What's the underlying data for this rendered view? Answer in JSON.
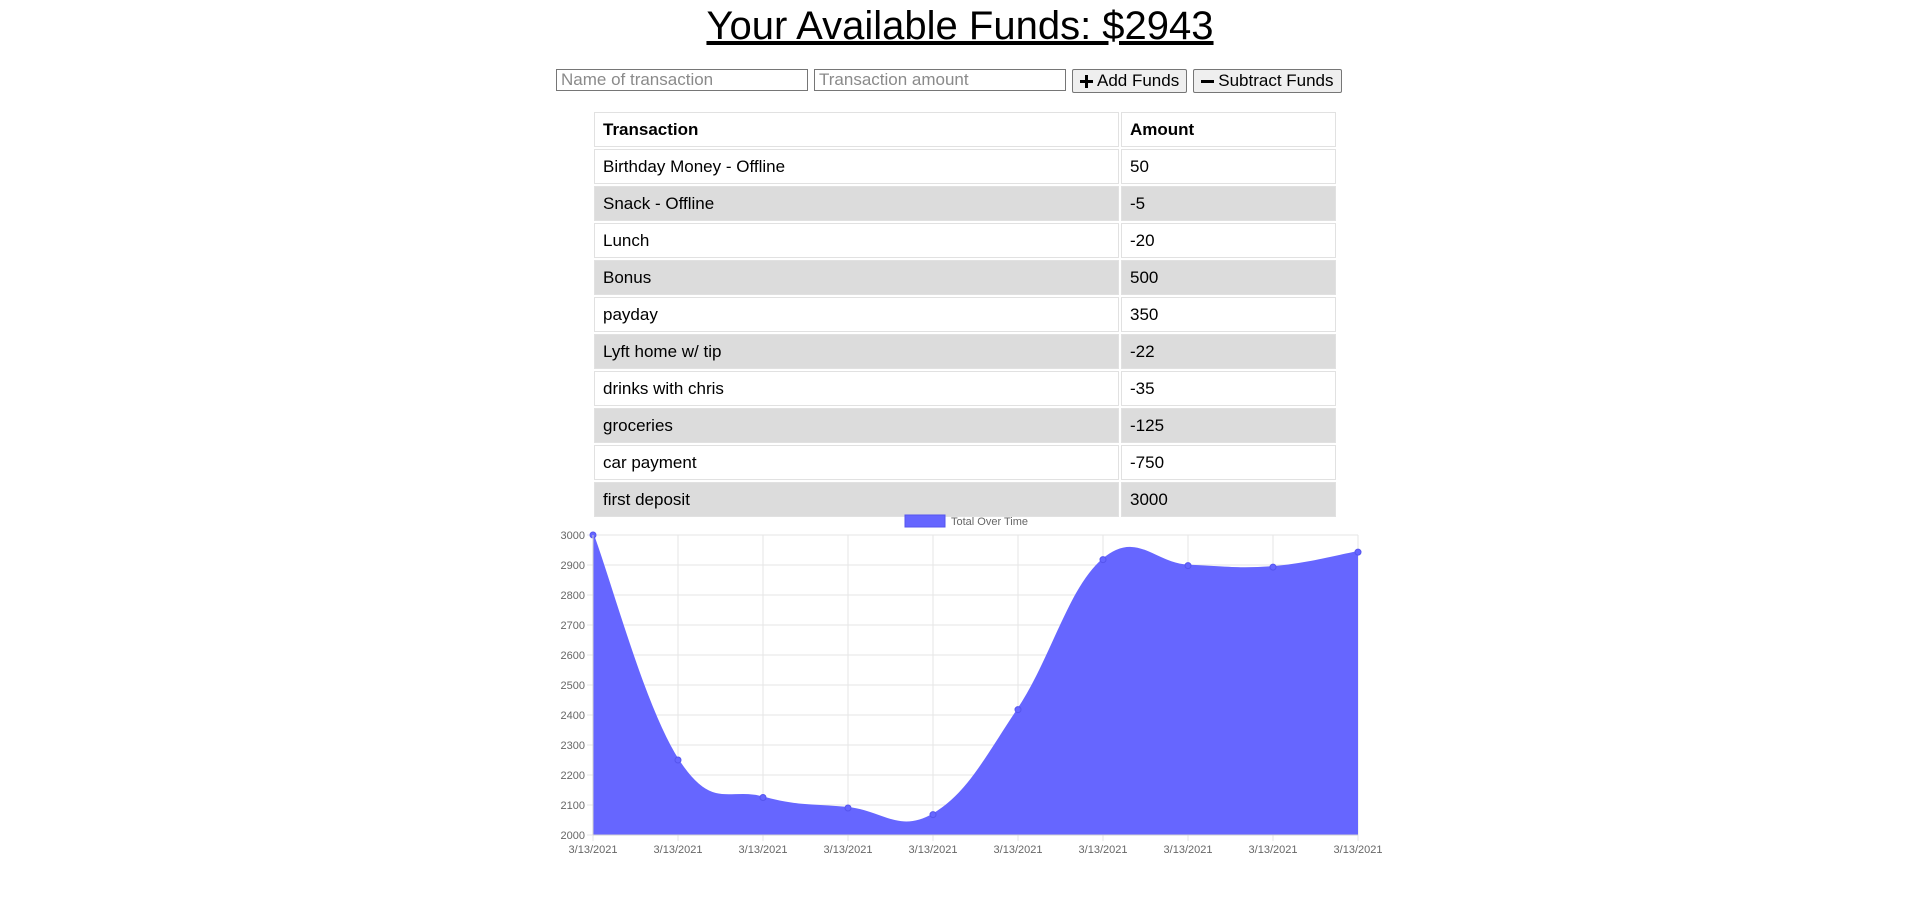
{
  "header": {
    "title": "Your Available Funds: $2943"
  },
  "form": {
    "name_placeholder": "Name of transaction",
    "amount_placeholder": "Transaction amount",
    "add_label": "Add Funds",
    "subtract_label": "Subtract Funds"
  },
  "table": {
    "headers": [
      "Transaction",
      "Amount"
    ],
    "rows": [
      {
        "name": "Birthday Money - Offline",
        "amount": "50"
      },
      {
        "name": "Snack - Offline",
        "amount": "-5"
      },
      {
        "name": "Lunch",
        "amount": "-20"
      },
      {
        "name": "Bonus",
        "amount": "500"
      },
      {
        "name": "payday",
        "amount": "350"
      },
      {
        "name": "Lyft home w/ tip",
        "amount": "-22"
      },
      {
        "name": "drinks with chris",
        "amount": "-35"
      },
      {
        "name": "groceries",
        "amount": "-125"
      },
      {
        "name": "car payment",
        "amount": "-750"
      },
      {
        "name": "first deposit",
        "amount": "3000"
      }
    ]
  },
  "colors": {
    "fill": "#6666ff",
    "grid": "#e6e6e6",
    "alt_row": "#dcdcdc"
  },
  "icons": {
    "add": "plus-icon",
    "subtract": "minus-icon"
  },
  "chart_data": {
    "type": "area",
    "x": [
      "3/13/2021",
      "3/13/2021",
      "3/13/2021",
      "3/13/2021",
      "3/13/2021",
      "3/13/2021",
      "3/13/2021",
      "3/13/2021",
      "3/13/2021",
      "3/13/2021"
    ],
    "series": [
      {
        "name": "Total Over Time",
        "values": [
          3000,
          2250,
          2125,
          2090,
          2068,
          2418,
          2918,
          2898,
          2893,
          2943
        ]
      }
    ],
    "ylim": [
      2000,
      3000
    ],
    "yticks": [
      3000,
      2900,
      2800,
      2700,
      2600,
      2500,
      2400,
      2300,
      2200,
      2100,
      2000
    ],
    "grid": true,
    "legend": "top-center"
  }
}
